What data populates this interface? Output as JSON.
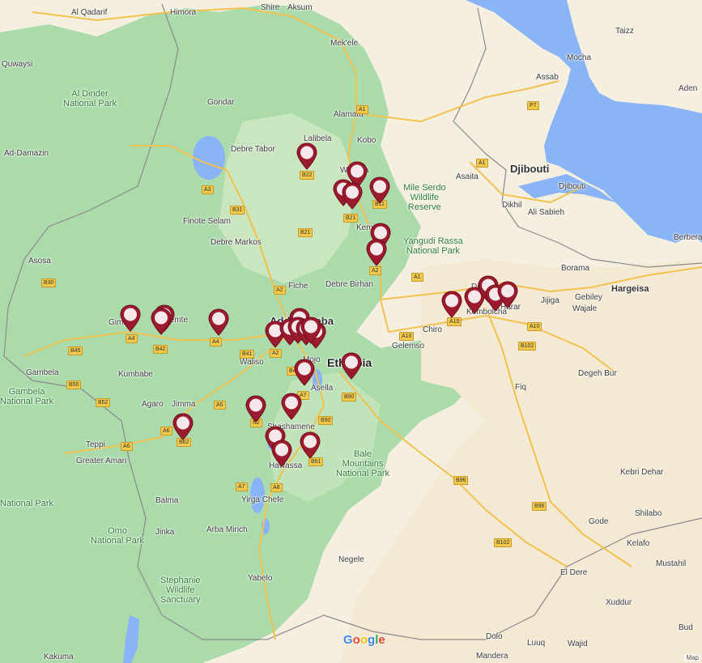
{
  "map": {
    "country_label": "Ethiopia",
    "logo": "Google",
    "attribution": "Map",
    "colors": {
      "land": "#f5efe0",
      "green": "#a6d9a8",
      "water": "#8ab4f8",
      "road": "#f2c14e",
      "border": "#8a8a8a",
      "pin": "#9c1a2d"
    },
    "labels": [
      {
        "id": "country",
        "text": "Ethiopia",
        "cls": "big"
      },
      {
        "id": "djibouti",
        "text": "Djibouti",
        "cls": "med"
      },
      {
        "id": "addis",
        "text": "Addis Ababa",
        "cls": "med"
      },
      {
        "id": "hargeisa",
        "text": "Hargeisa",
        "cls": "city"
      },
      {
        "id": "alqadarif",
        "text": "Al Qadarif"
      },
      {
        "id": "himora",
        "text": "Himora"
      },
      {
        "id": "shire",
        "text": "Shire"
      },
      {
        "id": "aksum",
        "text": "Aksum"
      },
      {
        "id": "mekele",
        "text": "Mek'ele"
      },
      {
        "id": "taizz",
        "text": "Taizz"
      },
      {
        "id": "mocha",
        "text": "Mocha"
      },
      {
        "id": "assab",
        "text": "Assab"
      },
      {
        "id": "aden",
        "text": "Aden"
      },
      {
        "id": "quwaysi",
        "text": "Quwaysi"
      },
      {
        "id": "gondar",
        "text": "Gondar"
      },
      {
        "id": "alamata",
        "text": "Alamata"
      },
      {
        "id": "lalibela",
        "text": "Lalibela"
      },
      {
        "id": "kobo",
        "text": "Kobo"
      },
      {
        "id": "addamazin",
        "text": "Ad-Damazin"
      },
      {
        "id": "debretabor",
        "text": "Debre Tabor"
      },
      {
        "id": "weldiya",
        "text": "Weldiya"
      },
      {
        "id": "asaita",
        "text": "Asaita"
      },
      {
        "id": "dikhil",
        "text": "Dikhil"
      },
      {
        "id": "alisabieh",
        "text": "Ali Sabieh"
      },
      {
        "id": "djibouticity",
        "text": "Djibouti"
      },
      {
        "id": "finoteselam",
        "text": "Finote Selam"
      },
      {
        "id": "debremarkos",
        "text": "Debre Markos"
      },
      {
        "id": "kemise",
        "text": "Kemise"
      },
      {
        "id": "berbera",
        "text": "Berbera"
      },
      {
        "id": "asosa",
        "text": "Asosa"
      },
      {
        "id": "fiche",
        "text": "Fiche"
      },
      {
        "id": "debrebirhan",
        "text": "Debre Birhan"
      },
      {
        "id": "borama",
        "text": "Borama"
      },
      {
        "id": "gebiley",
        "text": "Gebiley"
      },
      {
        "id": "wajale",
        "text": "Wajale"
      },
      {
        "id": "direDawa",
        "text": "Dire Dawa"
      },
      {
        "id": "jijiga",
        "text": "Jijiga"
      },
      {
        "id": "harar",
        "text": "Harar"
      },
      {
        "id": "kombolcha",
        "text": "Kombolcha"
      },
      {
        "id": "gimbi",
        "text": "Gimbi"
      },
      {
        "id": "nekemte",
        "text": "Nekemte"
      },
      {
        "id": "chiro",
        "text": "Chiro"
      },
      {
        "id": "waliso",
        "text": "Waliso"
      },
      {
        "id": "gelemso",
        "text": "Gelemso"
      },
      {
        "id": "mojo",
        "text": "Mojo"
      },
      {
        "id": "gambela",
        "text": "Gambela"
      },
      {
        "id": "kumbabe",
        "text": "Kumbabe"
      },
      {
        "id": "degehbur",
        "text": "Degeh Bur"
      },
      {
        "id": "asella",
        "text": "Asella"
      },
      {
        "id": "agaro",
        "text": "Agaro"
      },
      {
        "id": "jimma",
        "text": "Jimma"
      },
      {
        "id": "fiq",
        "text": "Fiq"
      },
      {
        "id": "shashamene",
        "text": "Shashamene"
      },
      {
        "id": "teppi",
        "text": "Teppi"
      },
      {
        "id": "greateraman",
        "text": "Greater Aman"
      },
      {
        "id": "hawassa",
        "text": "Hawassa"
      },
      {
        "id": "kebridehar",
        "text": "Kebri Dehar"
      },
      {
        "id": "balma",
        "text": "Balma"
      },
      {
        "id": "yirgachefe",
        "text": "Yirga Chefe"
      },
      {
        "id": "shilabo",
        "text": "Shilabo"
      },
      {
        "id": "gode",
        "text": "Gode"
      },
      {
        "id": "jinka",
        "text": "Jinka"
      },
      {
        "id": "arbaminch",
        "text": "Arba Minch"
      },
      {
        "id": "kelafo",
        "text": "Kelafo"
      },
      {
        "id": "negele",
        "text": "Negele"
      },
      {
        "id": "mustahil",
        "text": "Mustahil"
      },
      {
        "id": "yabelo",
        "text": "Yabelo"
      },
      {
        "id": "eldere",
        "text": "El Dere"
      },
      {
        "id": "xuddur",
        "text": "Xuddur"
      },
      {
        "id": "dolo",
        "text": "Dolo"
      },
      {
        "id": "luuq",
        "text": "Luuq"
      },
      {
        "id": "wajid",
        "text": "Wajid"
      },
      {
        "id": "mandera",
        "text": "Mandera"
      },
      {
        "id": "kakuma",
        "text": "Kakuma"
      },
      {
        "id": "budgo",
        "text": "Bud"
      }
    ],
    "parks": [
      {
        "id": "aldinder",
        "text": "Al Dinder\nNational Park"
      },
      {
        "id": "milleserdo",
        "text": "Mile Serdo\nWildlife\nReserve"
      },
      {
        "id": "yangudi",
        "text": "Yangudi Rassa\nNational Park"
      },
      {
        "id": "gambelapark",
        "text": "Gambela\nNational Park"
      },
      {
        "id": "bale",
        "text": "Bale\nMountains\nNational Park"
      },
      {
        "id": "omo",
        "text": "Omo\nNational Park"
      },
      {
        "id": "stephanie",
        "text": "Stephanie\nWildlife\nSanctuary"
      },
      {
        "id": "boma",
        "text": "National Park"
      }
    ],
    "shields": [
      "B22",
      "B21",
      "B21",
      "B11",
      "A2",
      "B31",
      "A3",
      "A2",
      "A1",
      "P7",
      "A1",
      "A1",
      "A10",
      "A10",
      "A10",
      "B102",
      "A4",
      "A4",
      "B42",
      "B45",
      "B41",
      "A5",
      "A6",
      "B50",
      "B52",
      "B62",
      "A6",
      "A7",
      "A7",
      "A8",
      "B4",
      "B61",
      "B90",
      "B96",
      "B96",
      "B102",
      "B90",
      "A2",
      "B30",
      "N2"
    ]
  }
}
